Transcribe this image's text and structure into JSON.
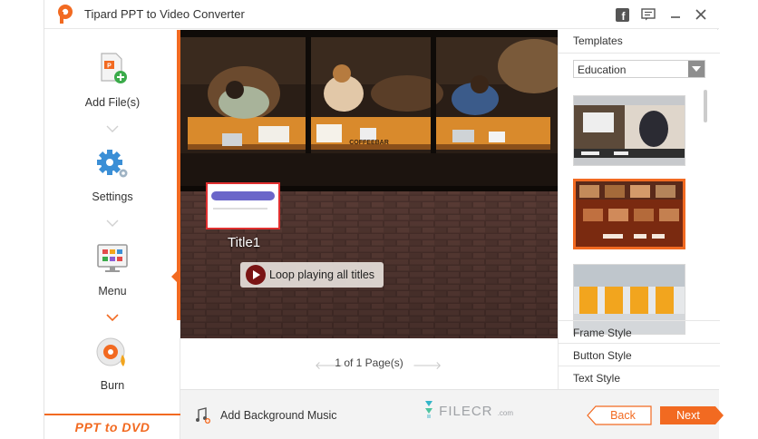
{
  "app": {
    "title": "Tipard PPT to Video Converter",
    "brand": "PPT to DVD"
  },
  "titlebar": {
    "facebook_icon": "facebook-icon",
    "feedback_icon": "feedback-icon",
    "minimize_icon": "minimize-icon",
    "close_icon": "close-icon"
  },
  "sidebar": {
    "steps": [
      {
        "label": "Add File(s)",
        "icon": "add-file-icon"
      },
      {
        "label": "Settings",
        "icon": "settings-gear-icon"
      },
      {
        "label": "Menu",
        "icon": "menu-monitor-icon"
      },
      {
        "label": "Burn",
        "icon": "burn-disc-icon"
      }
    ],
    "active_step": "Menu"
  },
  "preview": {
    "title_item": "Title1",
    "loop_button": "Loop playing all titles",
    "sign_text": "COFFEEBAR"
  },
  "pager": {
    "text": "1 of 1 Page(s)"
  },
  "right_panel": {
    "header": "Templates",
    "category": "Education",
    "templates_count_visible": 3,
    "selected_template": 2,
    "sections": [
      "Frame Style",
      "Button Style",
      "Text Style"
    ]
  },
  "bottom": {
    "music_label": "Add Background Music",
    "watermark": "FILECR",
    "watermark_suffix": ".com",
    "back_label": "Back",
    "next_label": "Next"
  },
  "colors": {
    "accent": "#f26a21",
    "selection_border": "#e03030",
    "loop_icon": "#7a1414"
  }
}
